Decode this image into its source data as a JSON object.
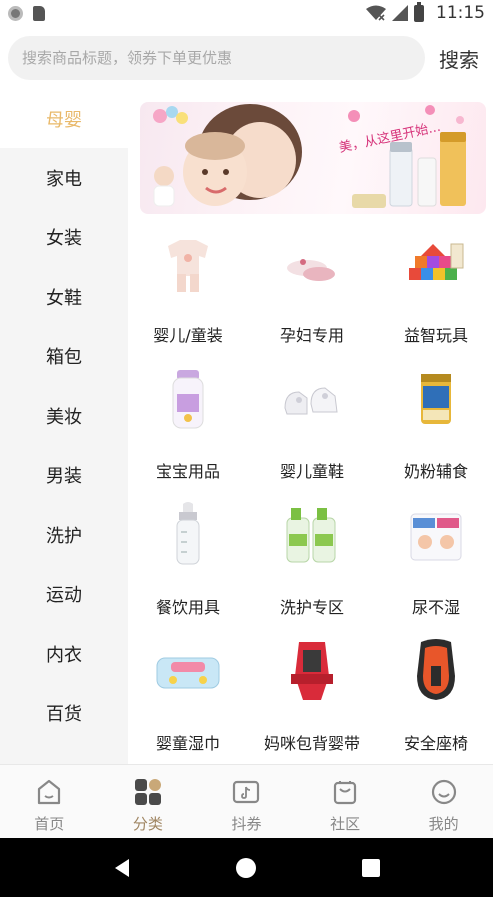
{
  "status_bar": {
    "time": "11:15"
  },
  "search": {
    "placeholder": "搜索商品标题，领券下单更优惠",
    "button_label": "搜索"
  },
  "sidebar": {
    "items": [
      {
        "label": "母婴",
        "active": true
      },
      {
        "label": "家电"
      },
      {
        "label": "女装"
      },
      {
        "label": "女鞋"
      },
      {
        "label": "箱包"
      },
      {
        "label": "美妆"
      },
      {
        "label": "男装"
      },
      {
        "label": "洗护"
      },
      {
        "label": "运动"
      },
      {
        "label": "内衣"
      },
      {
        "label": "百货"
      }
    ]
  },
  "banner": {
    "slogan": "美，从这里开始..."
  },
  "categories": [
    {
      "label": "婴儿/童装",
      "icon": "baby-clothes-icon"
    },
    {
      "label": "孕妇专用",
      "icon": "maternity-shoes-icon"
    },
    {
      "label": "益智玩具",
      "icon": "building-blocks-icon"
    },
    {
      "label": "宝宝用品",
      "icon": "baby-lotion-icon"
    },
    {
      "label": "婴儿童鞋",
      "icon": "baby-shoes-icon"
    },
    {
      "label": "奶粉辅食",
      "icon": "milk-powder-icon"
    },
    {
      "label": "餐饮用具",
      "icon": "baby-bottle-icon"
    },
    {
      "label": "洗护专区",
      "icon": "detergent-icon"
    },
    {
      "label": "尿不湿",
      "icon": "diaper-icon"
    },
    {
      "label": "婴童湿巾",
      "icon": "wet-wipes-icon"
    },
    {
      "label": "妈咪包背婴带",
      "icon": "baby-carrier-icon"
    },
    {
      "label": "安全座椅",
      "icon": "car-seat-icon"
    }
  ],
  "tabbar": {
    "tabs": [
      {
        "label": "首页",
        "icon": "home-icon"
      },
      {
        "label": "分类",
        "icon": "category-icon",
        "active": true
      },
      {
        "label": "抖券",
        "icon": "douyin-icon"
      },
      {
        "label": "社区",
        "icon": "bag-icon"
      },
      {
        "label": "我的",
        "icon": "smile-icon"
      }
    ]
  },
  "colors": {
    "accent": "#e9b96a",
    "active_tab": "#a08663",
    "sidebar_bg": "#f5f5f5"
  }
}
